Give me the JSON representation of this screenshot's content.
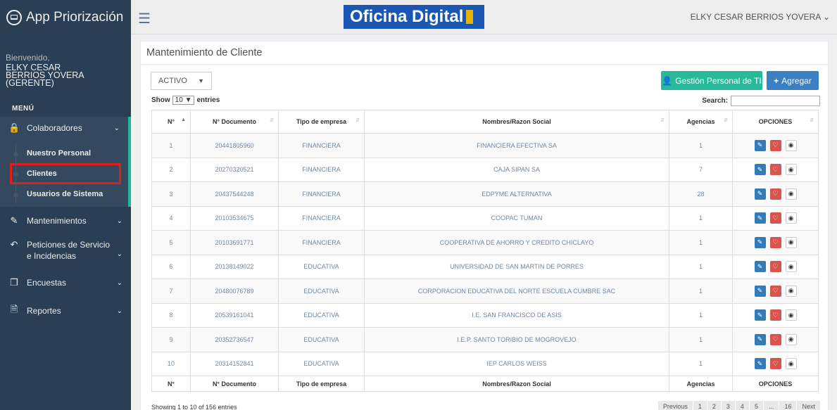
{
  "sidebar": {
    "brand": "App Priorización",
    "welcome": "Bienvenido,",
    "user": "ELKY CESAR BERRIOS YOVERA (GERENTE)",
    "menu_title": "MENÚ",
    "items": [
      {
        "label": "Colaboradores",
        "icon": "lock-icon"
      },
      {
        "label": "Mantenimientos",
        "icon": "edit-icon"
      },
      {
        "label": "Peticiones de Servicio e Incidencias",
        "icon": "reply-icon"
      },
      {
        "label": "Encuestas",
        "icon": "copy-icon"
      },
      {
        "label": "Reportes",
        "icon": "file-icon"
      }
    ],
    "subitems": [
      "Nuestro Personal",
      "Clientes",
      "Usuarios de Sistema"
    ]
  },
  "topbar": {
    "logo": "Oficina Digital",
    "user": "ELKY CESAR BERRIOS YOVERA"
  },
  "panel": {
    "title": "Mantenimiento de Cliente",
    "status": "ACTIVO",
    "btn_personal": "Gestión Personal de TI",
    "btn_add": "Agregar",
    "show_label": "Show",
    "show_value": "10",
    "entries_label": "entries",
    "search_label": "Search:",
    "columns": [
      "N°",
      "N° Documento",
      "Tipo de empresa",
      "Nombres/Razon Social",
      "Agencias",
      "OPCIONES"
    ],
    "rows": [
      [
        "1",
        "20441805960",
        "FINANCIERA",
        "FINANCIERA EFECTIVA SA",
        "1"
      ],
      [
        "2",
        "20270320521",
        "FINANCIERA",
        "CAJA SIPAN SA",
        "7"
      ],
      [
        "3",
        "20437544248",
        "FINANCIERA",
        "EDPYME ALTERNATIVA",
        "28"
      ],
      [
        "4",
        "20103534675",
        "FINANCIERA",
        "COOPAC TUMAN",
        "1"
      ],
      [
        "5",
        "20103691771",
        "FINANCIERA",
        "COOPERATIVA DE AHORRO Y CREDITO CHICLAYO",
        "1"
      ],
      [
        "6",
        "20138149022",
        "EDUCATIVA",
        "UNIVERSIDAD DE SAN MARTIN DE PORRES",
        "1"
      ],
      [
        "7",
        "20480076789",
        "EDUCATIVA",
        "CORPORACION EDUCATIVA DEL NORTE ESCUELA CUMBRE SAC",
        "1"
      ],
      [
        "8",
        "20539161041",
        "EDUCATIVA",
        "I.E. SAN FRANCISCO DE ASIS",
        "1"
      ],
      [
        "9",
        "20352736547",
        "EDUCATIVA",
        "I.E.P. SANTO TORIBIO DE MOGROVEJO",
        "1"
      ],
      [
        "10",
        "20314152841",
        "EDUCATIVA",
        "IEP CARLOS WEISS",
        "1"
      ]
    ],
    "info": "Showing 1 to 10 of 156 entries",
    "pages": [
      "Previous",
      "1",
      "2",
      "3",
      "4",
      "5",
      "...",
      "16",
      "Next"
    ]
  }
}
